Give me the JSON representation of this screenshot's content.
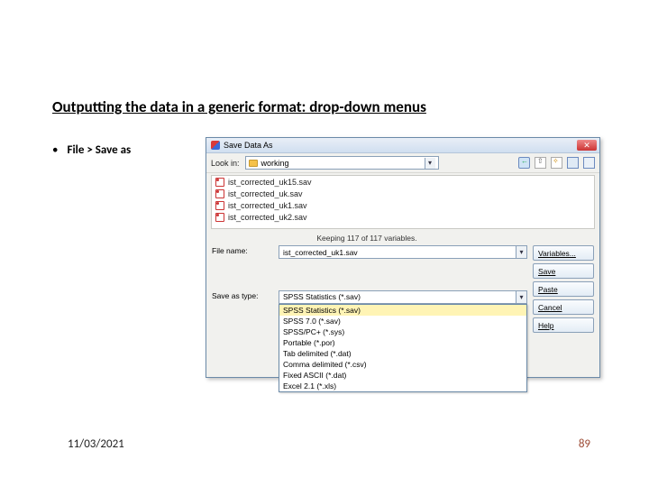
{
  "slide": {
    "title": "Outputting the data in a generic format: drop-down menus",
    "bullet": "File > Save as",
    "date": "11/03/2021",
    "page": "89"
  },
  "dialog": {
    "title": "Save Data As",
    "look_in_label": "Look in:",
    "look_in_value": "working",
    "file_list": [
      "ist_corrected_uk15.sav",
      "ist_corrected_uk.sav",
      "ist_corrected_uk1.sav",
      "ist_corrected_uk2.sav"
    ],
    "keeping_text": "Keeping 117 of 117 variables.",
    "file_name_label": "File name:",
    "file_name_value": "ist_corrected_uk1.sav",
    "save_as_type_label": "Save as type:",
    "save_as_type_selected": "SPSS Statistics (*.sav)",
    "type_options": [
      "SPSS Statistics (*.sav)",
      "SPSS 7.0 (*.sav)",
      "SPSS/PC+ (*.sys)",
      "Portable (*.por)",
      "Tab delimited (*.dat)",
      "Comma delimited (*.csv)",
      "Fixed ASCII (*.dat)",
      "Excel 2.1 (*.xls)"
    ],
    "buttons": {
      "variables": "Variables...",
      "save": "Save",
      "paste": "Paste",
      "cancel": "Cancel",
      "help": "Help"
    }
  }
}
